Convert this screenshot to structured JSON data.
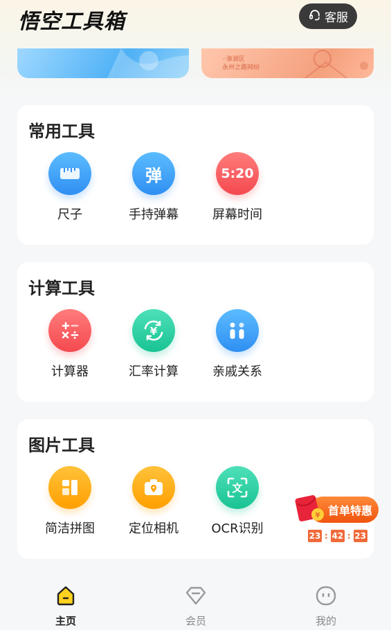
{
  "header": {
    "app_title": "悟空工具箱",
    "service_label": "客服"
  },
  "banner": {
    "right_text_line1": "··淮湖区",
    "right_text_line2": "永州之路网纷"
  },
  "sections": [
    {
      "title": "常用工具",
      "tools": [
        {
          "label": "尺子",
          "icon": "ruler-icon",
          "color": "#2f8ff2"
        },
        {
          "label": "手持弹幕",
          "icon": "bullet-comment-icon",
          "glyph": "弹",
          "color": "#2f8ff2"
        },
        {
          "label": "屏幕时间",
          "icon": "screen-time-icon",
          "glyph": "5:20",
          "color": "#f4494f"
        }
      ]
    },
    {
      "title": "计算工具",
      "tools": [
        {
          "label": "计算器",
          "icon": "calculator-icon",
          "color": "#f4494f"
        },
        {
          "label": "汇率计算",
          "icon": "exchange-rate-icon",
          "glyph": "¥",
          "color": "#19c393"
        },
        {
          "label": "亲戚关系",
          "icon": "relatives-icon",
          "color": "#2f8ff2"
        }
      ]
    },
    {
      "title": "图片工具",
      "tools": [
        {
          "label": "简洁拼图",
          "icon": "collage-icon",
          "color": "#ff9f00"
        },
        {
          "label": "定位相机",
          "icon": "location-camera-icon",
          "color": "#ff9f00"
        },
        {
          "label": "OCR识别",
          "icon": "ocr-scan-icon",
          "glyph": "文",
          "color": "#19c393"
        }
      ]
    }
  ],
  "promo": {
    "label": "首单特惠",
    "countdown": {
      "hours": "23",
      "minutes": "42",
      "seconds": "23"
    }
  },
  "tabbar": {
    "tabs": [
      {
        "label": "主页",
        "icon": "home-icon",
        "active": true
      },
      {
        "label": "会员",
        "icon": "diamond-icon",
        "active": false
      },
      {
        "label": "我的",
        "icon": "profile-face-icon",
        "active": false
      }
    ]
  }
}
